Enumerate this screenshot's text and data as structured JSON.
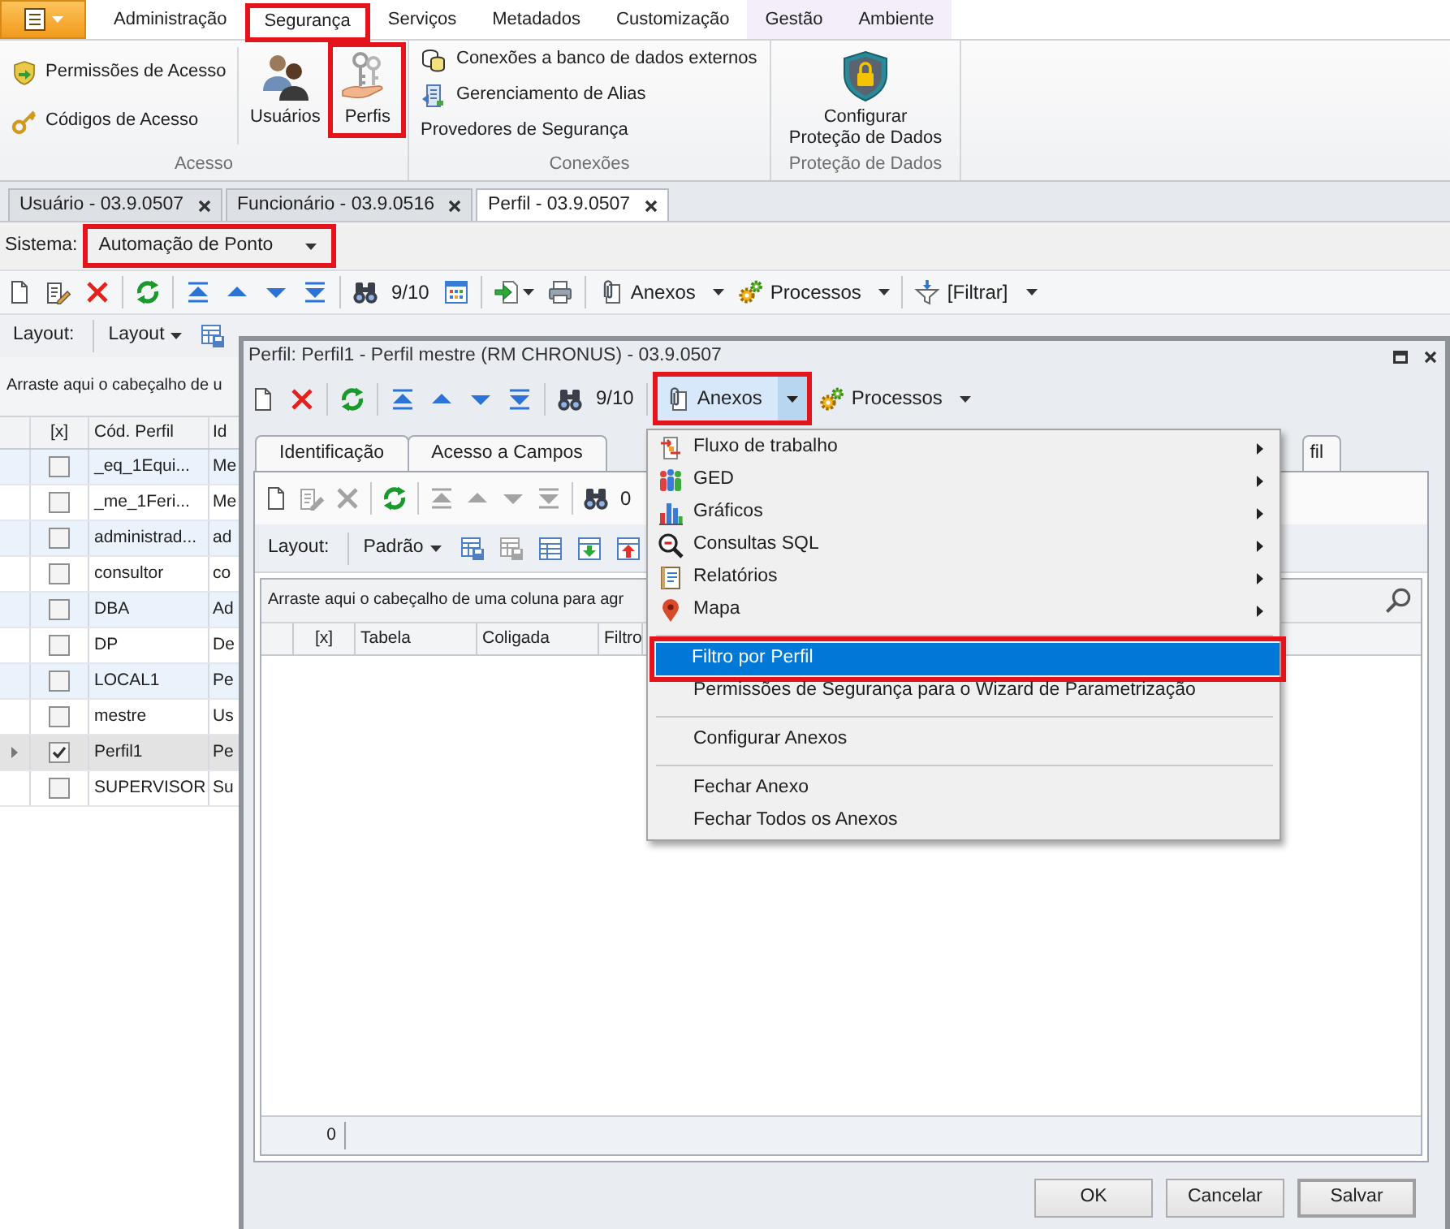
{
  "ribbon": {
    "tabs": [
      {
        "label": "Administração",
        "kind": "normal",
        "selected": false,
        "highlighted": false
      },
      {
        "label": "Segurança",
        "kind": "normal",
        "selected": true,
        "highlighted": true
      },
      {
        "label": "Serviços",
        "kind": "normal",
        "selected": false,
        "highlighted": false
      },
      {
        "label": "Metadados",
        "kind": "normal",
        "selected": false,
        "highlighted": false
      },
      {
        "label": "Customização",
        "kind": "normal",
        "selected": false,
        "highlighted": false
      },
      {
        "label": "Gestão",
        "kind": "contextual",
        "selected": false,
        "highlighted": false
      },
      {
        "label": "Ambiente",
        "kind": "contextual",
        "selected": false,
        "highlighted": false
      }
    ],
    "groups": [
      {
        "label": "Acesso",
        "items": [
          {
            "kind": "small",
            "label": "Permissões de Acesso",
            "highlighted": false
          },
          {
            "kind": "small",
            "label": "Códigos de Acesso",
            "highlighted": false
          },
          {
            "kind": "large",
            "label": "Usuários",
            "highlighted": false
          },
          {
            "kind": "large",
            "label": "Perfis",
            "highlighted": true
          }
        ]
      },
      {
        "label": "Conexões",
        "items": [
          {
            "kind": "small",
            "label": "Conexões a banco de dados externos",
            "highlighted": false
          },
          {
            "kind": "small",
            "label": "Gerenciamento de Alias",
            "highlighted": false
          },
          {
            "kind": "small",
            "label": "Provedores de Segurança",
            "highlighted": false
          }
        ]
      },
      {
        "label": "Proteção de Dados",
        "items": [
          {
            "kind": "large",
            "label": "Configurar Proteção de Dados",
            "highlighted": false
          }
        ]
      }
    ]
  },
  "document_tabs": [
    {
      "label": "Usuário - 03.9.0507",
      "selected": false
    },
    {
      "label": "Funcionário - 03.9.0516",
      "selected": false
    },
    {
      "label": "Perfil - 03.9.0507",
      "selected": true
    }
  ],
  "system": {
    "label": "Sistema:",
    "value": "Automação de Ponto",
    "highlighted": true
  },
  "toolbar": {
    "counter": "9/10",
    "menus": [
      {
        "label": "Anexos"
      },
      {
        "label": "Processos"
      },
      {
        "label": "[Filtrar]"
      }
    ]
  },
  "layout_bar": {
    "label": "Layout:",
    "value": "Layout"
  },
  "grid": {
    "group_hint": "Arraste aqui o cabeçalho de u",
    "columns": [
      "[x]",
      "Cód. Perfil",
      "Id"
    ],
    "rows": [
      {
        "code": "_eq_1Equi...",
        "column_3": "Me",
        "checked": false,
        "selected": false
      },
      {
        "code": "_me_1Feri...",
        "column_3": "Me",
        "checked": false,
        "selected": false
      },
      {
        "code": "administrad...",
        "column_3": "ad",
        "checked": false,
        "selected": false
      },
      {
        "code": "consultor",
        "column_3": "co",
        "checked": false,
        "selected": false
      },
      {
        "code": "DBA",
        "column_3": "Ad",
        "checked": false,
        "selected": false
      },
      {
        "code": "DP",
        "column_3": "De",
        "checked": false,
        "selected": false
      },
      {
        "code": "LOCAL1",
        "column_3": "Pe",
        "checked": false,
        "selected": false
      },
      {
        "code": "mestre",
        "column_3": "Us",
        "checked": false,
        "selected": false
      },
      {
        "code": "Perfil1",
        "column_3": "Pe",
        "checked": true,
        "selected": true
      },
      {
        "code": "SUPERVISOR",
        "column_3": "Su",
        "checked": false,
        "selected": false
      }
    ]
  },
  "dialog": {
    "title": "Perfil: Perfil1 - Perfil mestre (RM CHRONUS) - 03.9.0507",
    "toolbar": {
      "counter": "9/10",
      "menus": [
        {
          "label": "Anexos",
          "pressed": true,
          "highlighted": true
        },
        {
          "label": "Processos",
          "pressed": false,
          "highlighted": false
        }
      ]
    },
    "tabs": [
      {
        "label": "Identificação"
      },
      {
        "label": "Acesso a Campos"
      },
      {
        "label": "fil"
      }
    ],
    "panel_toolbar": {
      "buttons": [
        {
          "disabled": false
        },
        {
          "disabled": true
        },
        {
          "disabled": true
        },
        {
          "disabled": false
        },
        {
          "disabled": true
        },
        {
          "disabled": true
        },
        {
          "disabled": true
        },
        {
          "disabled": true
        },
        {
          "disabled": false
        }
      ],
      "counter": "0"
    },
    "layout_bar": {
      "label": "Layout:",
      "value": "Padrão",
      "buttons": [
        {
          "disabled": false
        },
        {
          "disabled": true
        },
        {
          "disabled": false
        },
        {
          "disabled": false
        },
        {
          "disabled": false
        }
      ]
    },
    "grid": {
      "group_hint": "Arraste aqui o cabeçalho de uma coluna para agr",
      "columns": [
        "[x]",
        "Tabela",
        "Coligada",
        "Filtro"
      ],
      "row_count": "0"
    },
    "buttons": [
      {
        "label": "OK",
        "default": false
      },
      {
        "label": "Cancelar",
        "default": false
      },
      {
        "label": "Salvar",
        "default": true
      }
    ]
  },
  "menu": {
    "items": [
      {
        "kind": "submenu",
        "label": "Fluxo de trabalho",
        "selected": false,
        "highlighted": false
      },
      {
        "kind": "submenu",
        "label": "GED",
        "selected": false,
        "highlighted": false
      },
      {
        "kind": "submenu",
        "label": "Gráficos",
        "selected": false,
        "highlighted": false
      },
      {
        "kind": "submenu",
        "label": "Consultas SQL",
        "selected": false,
        "highlighted": false
      },
      {
        "kind": "submenu",
        "label": "Relatórios",
        "selected": false,
        "highlighted": false
      },
      {
        "kind": "submenu",
        "label": "Mapa",
        "selected": false,
        "highlighted": false
      },
      {
        "kind": "separator"
      },
      {
        "kind": "command",
        "label": "Filtro por Perfil",
        "selected": true,
        "highlighted": true
      },
      {
        "kind": "command",
        "label": "Permissões de Segurança para o Wizard de Parametrização",
        "selected": false,
        "highlighted": false
      },
      {
        "kind": "separator"
      },
      {
        "kind": "command",
        "label": "Configurar Anexos",
        "selected": false,
        "highlighted": false
      },
      {
        "kind": "separator"
      },
      {
        "kind": "command",
        "label": "Fechar Anexo",
        "selected": false,
        "highlighted": false
      },
      {
        "kind": "command",
        "label": "Fechar Todos os Anexos",
        "selected": false,
        "highlighted": false
      }
    ]
  }
}
